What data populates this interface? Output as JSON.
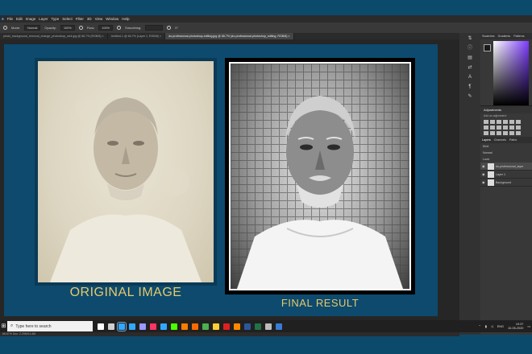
{
  "menu": [
    "File",
    "Edit",
    "Image",
    "Layer",
    "Type",
    "Select",
    "Filter",
    "3D",
    "View",
    "Window",
    "Help"
  ],
  "options": {
    "mode_label": "Mode:",
    "mode_value": "Normal",
    "opacity_label": "Opacity:",
    "opacity_value": "100%",
    "flow_label": "Flow:",
    "flow_value": "100%",
    "smoothing_label": "Smoothing:",
    "angle_value": "0°"
  },
  "tabs": [
    {
      "label": "photo_background_removal_change_photoshop_web.jpg @ 66.7% (RGB/8)",
      "active": false
    },
    {
      "label": "Untitled-1 @ 66.7% (Layer 1, RGB/8)",
      "active": false
    },
    {
      "label": "do-professional-photoshop-editing.jpg @ 66.7% (do-professional-photoshop_editing, RGB/8)",
      "active": true
    }
  ],
  "canvas": {
    "original_caption": "ORIGINAL IMAGE",
    "final_caption": "FINAL RESULT"
  },
  "status": "66.67%   Doc: 2.29M/11.6M",
  "panels": {
    "color_tabs": [
      "Swatches",
      "Gradients",
      "Patterns"
    ],
    "adjustments_title": "Adjustments",
    "adjustments_hint": "Add an adjustment",
    "layers_tabs": [
      "Layers",
      "Channels",
      "Paths"
    ],
    "kind_label": "Kind",
    "blend_mode": "Normal",
    "lock_label": "Lock:",
    "layers": [
      {
        "name": "do-professional_layer",
        "selected": true
      },
      {
        "name": "Layer 1",
        "selected": false
      },
      {
        "name": "Background",
        "selected": false
      }
    ]
  },
  "taskbar": {
    "search_placeholder": "Type here to search",
    "apps": [
      {
        "name": "search-circle",
        "color": "#ffffff"
      },
      {
        "name": "task-view",
        "color": "#cfcfcf"
      },
      {
        "name": "photoshop",
        "color": "#31a8ff",
        "active": true
      },
      {
        "name": "photoshop-2",
        "color": "#31a8ff"
      },
      {
        "name": "premiere",
        "color": "#9999ff"
      },
      {
        "name": "indesign",
        "color": "#ff3366"
      },
      {
        "name": "lightroom",
        "color": "#31a8ff"
      },
      {
        "name": "dreamweaver",
        "color": "#4cff00"
      },
      {
        "name": "animate",
        "color": "#ff7c00"
      },
      {
        "name": "firefox",
        "color": "#ff6a00"
      },
      {
        "name": "chrome",
        "color": "#4caf50"
      },
      {
        "name": "explorer",
        "color": "#ffcc33"
      },
      {
        "name": "acrobat",
        "color": "#e02020"
      },
      {
        "name": "vlc",
        "color": "#ff8800"
      },
      {
        "name": "word",
        "color": "#2b579a"
      },
      {
        "name": "excel",
        "color": "#217346"
      },
      {
        "name": "settings",
        "color": "#bbbbbb"
      },
      {
        "name": "photos",
        "color": "#3a7bd5"
      }
    ],
    "lang": "ENG",
    "time": "19:37",
    "date": "10-05-2020"
  }
}
